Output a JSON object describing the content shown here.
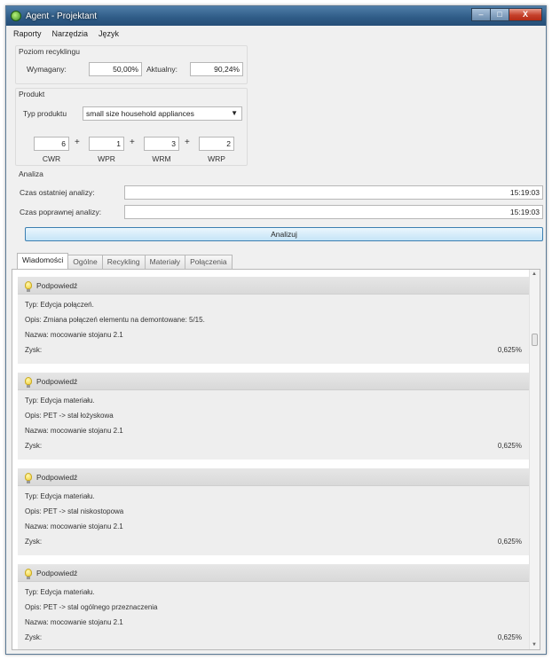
{
  "window": {
    "title": "Agent - Projektant",
    "controls": {
      "minimize": "–",
      "maximize": "□",
      "close": "X"
    }
  },
  "menu": [
    "Raporty",
    "Narzędzia",
    "Język"
  ],
  "recycling": {
    "group_title": "Poziom recyklingu",
    "required_label": "Wymagany:",
    "required_value": "50,00%",
    "actual_label": "Aktualny:",
    "actual_value": "90,24%"
  },
  "product": {
    "group_title": "Produkt",
    "type_label": "Typ produktu",
    "type_value": "small size household appliances",
    "weights": [
      {
        "value": "6",
        "label": "CWR"
      },
      {
        "value": "1",
        "label": "WPR"
      },
      {
        "value": "3",
        "label": "WRM"
      },
      {
        "value": "2",
        "label": "WRP"
      }
    ],
    "plus": "+"
  },
  "analysis": {
    "group_title": "Analiza",
    "last_label": "Czas ostatniej analizy:",
    "last_value": "15:19:03",
    "correct_label": "Czas poprawnej analizy:",
    "correct_value": "15:19:03",
    "button_label": "Analizuj"
  },
  "tabs": [
    "Wiadomości",
    "Ogólne",
    "Recykling",
    "Materiały",
    "Połączenia"
  ],
  "messages": [
    {
      "header": "Podpowiedź",
      "typ_label": "Typ:",
      "typ": "Edycja połączeń.",
      "opis_label": "Opis:",
      "opis": "Zmiana połączeń elementu na demontowane: 5/15.",
      "nazwa_label": "Nazwa:",
      "nazwa": "mocowanie stojanu 2.1",
      "zysk_label": "Zysk:",
      "zysk": "0,625%"
    },
    {
      "header": "Podpowiedź",
      "typ_label": "Typ:",
      "typ": "Edycja materiału.",
      "opis_label": "Opis:",
      "opis": "PET -> stal łożyskowa",
      "nazwa_label": "Nazwa:",
      "nazwa": "mocowanie stojanu 2.1",
      "zysk_label": "Zysk:",
      "zysk": "0,625%"
    },
    {
      "header": "Podpowiedź",
      "typ_label": "Typ:",
      "typ": "Edycja materiału.",
      "opis_label": "Opis:",
      "opis": "PET -> stal niskostopowa",
      "nazwa_label": "Nazwa:",
      "nazwa": "mocowanie stojanu 2.1",
      "zysk_label": "Zysk:",
      "zysk": "0,625%"
    },
    {
      "header": "Podpowiedź",
      "typ_label": "Typ:",
      "typ": "Edycja materiału.",
      "opis_label": "Opis:",
      "opis": "PET -> stal ogólnego przeznaczenia",
      "nazwa_label": "Nazwa:",
      "nazwa": "mocowanie stojanu 2.1",
      "zysk_label": "Zysk:",
      "zysk": "0,625%"
    }
  ]
}
